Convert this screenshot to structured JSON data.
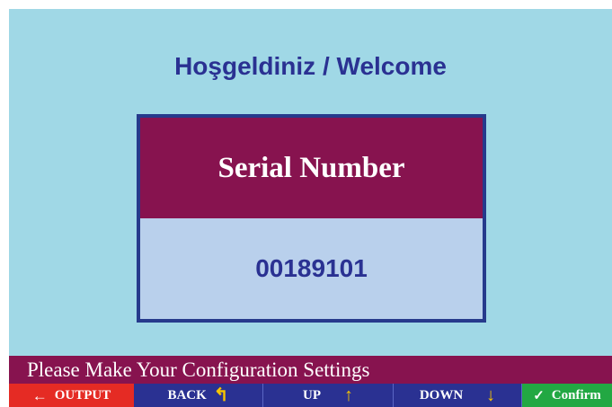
{
  "welcome": {
    "title": "Hoşgeldiniz / Welcome"
  },
  "serial": {
    "label": "Serial Number",
    "value": "00189101"
  },
  "status": {
    "message": "Please Make Your Configuration Settings"
  },
  "softkeys": {
    "output": {
      "label": "OUTPUT",
      "icon": "left-arrow-icon",
      "glyph": "←"
    },
    "back": {
      "label": "BACK",
      "icon": "return-arrow-icon",
      "glyph": "↰"
    },
    "up": {
      "label": "UP",
      "icon": "up-arrow-icon",
      "glyph": "↑"
    },
    "down": {
      "label": "DOWN",
      "icon": "down-arrow-icon",
      "glyph": "↓"
    },
    "confirm": {
      "label": "Confirm",
      "icon": "check-icon",
      "glyph": "✓"
    }
  },
  "colors": {
    "screen_bg": "#a0d8e6",
    "header_maroon": "#87134f",
    "navy": "#2a3192",
    "value_bg": "#b9d0ec",
    "output_red": "#e52b24",
    "confirm_green": "#22a843",
    "arrow_yellow": "#f7c500"
  }
}
